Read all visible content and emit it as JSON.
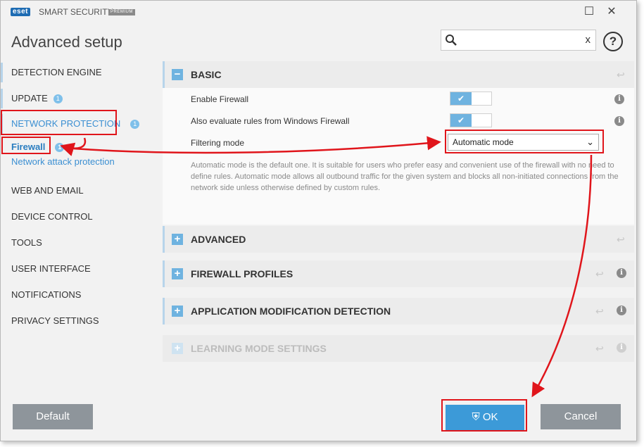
{
  "app": {
    "brand_logo": "eset",
    "product_name": "SMART SECURITY",
    "edition": "PREMIUM",
    "window_controls": {
      "maximize_icon": "maximize-icon",
      "close_icon": "close-icon"
    }
  },
  "header": {
    "title": "Advanced setup",
    "search": {
      "value": "",
      "placeholder": "",
      "clear_label": "x"
    },
    "help_label": "?"
  },
  "sidebar": {
    "items": [
      {
        "label": "DETECTION ENGINE"
      },
      {
        "label": "UPDATE",
        "badge": "1"
      },
      {
        "label": "NETWORK PROTECTION",
        "badge": "1"
      },
      {
        "label": "WEB AND EMAIL"
      },
      {
        "label": "DEVICE CONTROL"
      },
      {
        "label": "TOOLS"
      },
      {
        "label": "USER INTERFACE"
      },
      {
        "label": "NOTIFICATIONS"
      },
      {
        "label": "PRIVACY SETTINGS"
      }
    ],
    "subitems": [
      {
        "label": "Firewall",
        "badge": "1"
      },
      {
        "label": "Network attack protection"
      }
    ]
  },
  "main": {
    "basic": {
      "title": "BASIC",
      "rows": [
        {
          "label": "Enable Firewall",
          "enabled": true
        },
        {
          "label": "Also evaluate rules from Windows Firewall",
          "enabled": true
        }
      ],
      "filtering_label": "Filtering mode",
      "filtering_value": "Automatic mode",
      "description": "Automatic mode is the default one. It is suitable for users who prefer easy and convenient use of the firewall with no need to define rules. Automatic mode allows all outbound traffic for the given system and blocks all non-initiated connections from the network side unless otherwise defined by custom rules."
    },
    "sections": [
      {
        "title": "ADVANCED"
      },
      {
        "title": "FIREWALL PROFILES"
      },
      {
        "title": "APPLICATION MODIFICATION DETECTION"
      },
      {
        "title": "LEARNING MODE SETTINGS"
      }
    ]
  },
  "footer": {
    "default_label": "Default",
    "ok_label": "OK",
    "cancel_label": "Cancel"
  },
  "colors": {
    "accent": "#3c9ad8",
    "annotation": "#e0151b",
    "button_gray": "#8e959b"
  }
}
